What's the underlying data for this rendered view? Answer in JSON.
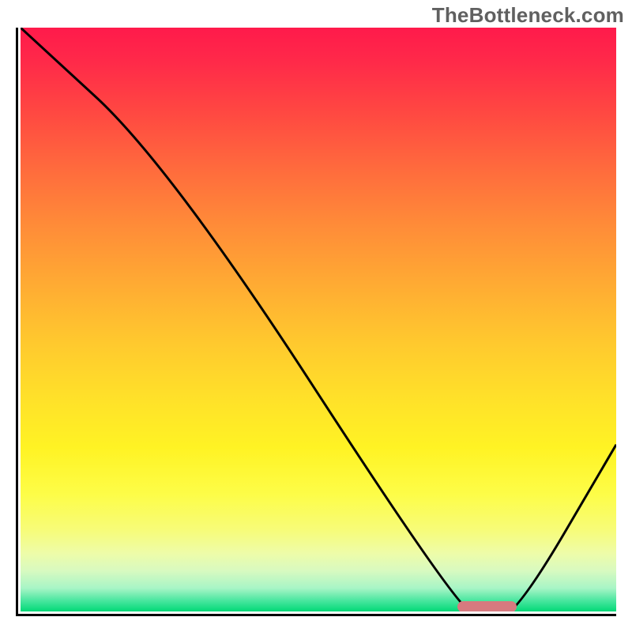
{
  "watermark": "TheBottleneck.com",
  "colors": {
    "axis": "#000000",
    "curve": "#000000",
    "marker": "#d77a7f"
  },
  "chart_data": {
    "type": "line",
    "title": "",
    "xlabel": "",
    "ylabel": "",
    "xlim": [
      0,
      100
    ],
    "ylim": [
      0,
      100
    ],
    "grid": false,
    "legend": false,
    "series": [
      {
        "name": "curve",
        "x": [
          0,
          25,
          73,
          78,
          83,
          100
        ],
        "y": [
          100,
          77,
          3,
          1,
          1,
          30
        ]
      }
    ],
    "marker": {
      "x_start": 73,
      "x_end": 83,
      "y": 1.2,
      "color": "#d77a7f"
    },
    "background_gradient": {
      "direction": "vertical",
      "low_value_color": "#02d977",
      "high_value_color": "#ff1a4b",
      "meaning": "green = good (low bottleneck), red = bad (high bottleneck)"
    }
  }
}
